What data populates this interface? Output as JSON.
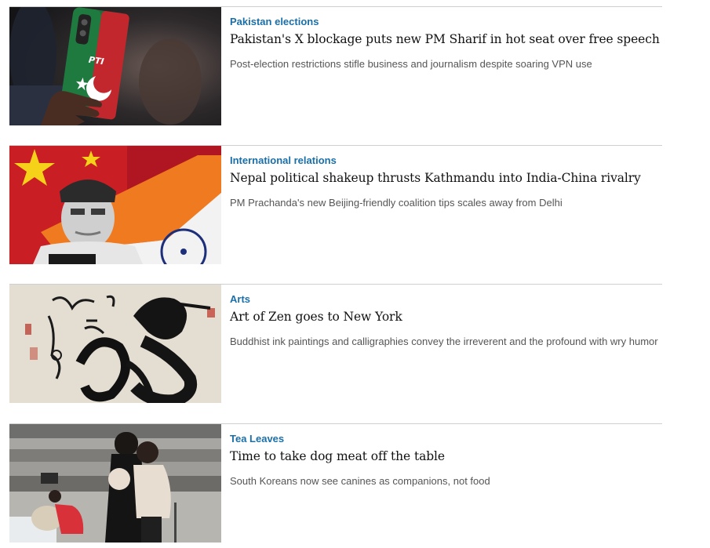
{
  "articles": [
    {
      "category": "Pakistan elections",
      "headline": "Pakistan's X blockage puts new PM Sharif in hot seat over free speech",
      "summary": "Post-election restrictions stifle business and journalism despite soaring VPN use",
      "image_text": "PTI"
    },
    {
      "category": "International relations",
      "headline": "Nepal political shakeup thrusts Kathmandu into India-China rivalry",
      "summary": "PM Prachanda's new Beijing-friendly coalition tips scales away from Delhi"
    },
    {
      "category": "Arts",
      "headline": "Art of Zen goes to New York",
      "summary": "Buddhist ink paintings and calligraphies convey the irreverent and the profound with wry humor"
    },
    {
      "category": "Tea Leaves",
      "headline": "Time to take dog meat off the table",
      "summary": "South Koreans now see canines as companions, not food"
    }
  ]
}
